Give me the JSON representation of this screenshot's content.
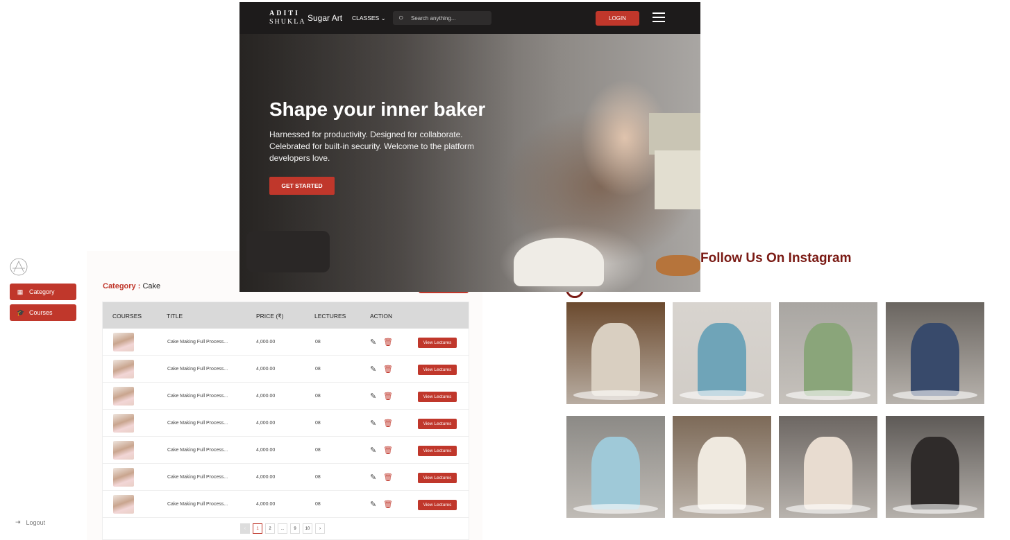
{
  "colors": {
    "accent": "#c0372b",
    "insta_title": "#7a1a14",
    "nav_bg": "#1d1b1b"
  },
  "sidebar": {
    "items": [
      {
        "label": "Category",
        "icon": "grid-icon"
      },
      {
        "label": "Courses",
        "icon": "graduation-cap-icon"
      }
    ],
    "logout_label": "Logout"
  },
  "category": {
    "prefix": "Category :",
    "value": "Cake"
  },
  "table": {
    "headers": [
      "COURSES",
      "TITLE",
      "PRICE (₹)",
      "LECTURES",
      "ACTION"
    ],
    "rows": [
      {
        "title": "Cake Making Full Process...",
        "price": "4,000.00",
        "lectures": "08",
        "button": "View Lectures"
      },
      {
        "title": "Cake Making Full Process...",
        "price": "4,000.00",
        "lectures": "08",
        "button": "View Lectures"
      },
      {
        "title": "Cake Making Full Process...",
        "price": "4,000.00",
        "lectures": "08",
        "button": "View Lectures"
      },
      {
        "title": "Cake Making Full Process...",
        "price": "4,000.00",
        "lectures": "08",
        "button": "View Lectures"
      },
      {
        "title": "Cake Making Full Process...",
        "price": "4,000.00",
        "lectures": "08",
        "button": "View Lectures"
      },
      {
        "title": "Cake Making Full Process...",
        "price": "4,000.00",
        "lectures": "08",
        "button": "View Lectures"
      },
      {
        "title": "Cake Making Full Process...",
        "price": "4,000.00",
        "lectures": "08",
        "button": "View Lectures"
      }
    ]
  },
  "pagination": {
    "pages": [
      "1",
      "2",
      "...",
      "9",
      "10"
    ],
    "prev": "‹",
    "next": "›"
  },
  "site": {
    "brand_top": "ADITI",
    "brand_bottom": "SHUKLA",
    "brand_name": "Sugar Art",
    "classes_label": "CLASSES ⌄",
    "search_placeholder": "Search anything...",
    "login_label": "LOGIN",
    "hero_title": "Shape your inner baker",
    "hero_sub": "Harnessed for productivity. Designed for collaborate. Celebrated for built-in security. Welcome to the platform developers love.",
    "cta_label": "GET STARTED"
  },
  "instagram": {
    "title": "Follow Us On Instagram",
    "posts": [
      {
        "bg": "#6b4a2e",
        "cake": "#d9cfc1"
      },
      {
        "bg": "#d8d4cf",
        "cake": "#6fa4b8"
      },
      {
        "bg": "#a9a6a2",
        "cake": "#8aa57a"
      },
      {
        "bg": "#6a6560",
        "cake": "#384a6b"
      },
      {
        "bg": "#8c8a86",
        "cake": "#9fc9d8"
      },
      {
        "bg": "#7d6a58",
        "cake": "#efe9df"
      },
      {
        "bg": "#6d6763",
        "cake": "#e8dcd0"
      },
      {
        "bg": "#5e5a57",
        "cake": "#2f2b2a"
      }
    ]
  }
}
